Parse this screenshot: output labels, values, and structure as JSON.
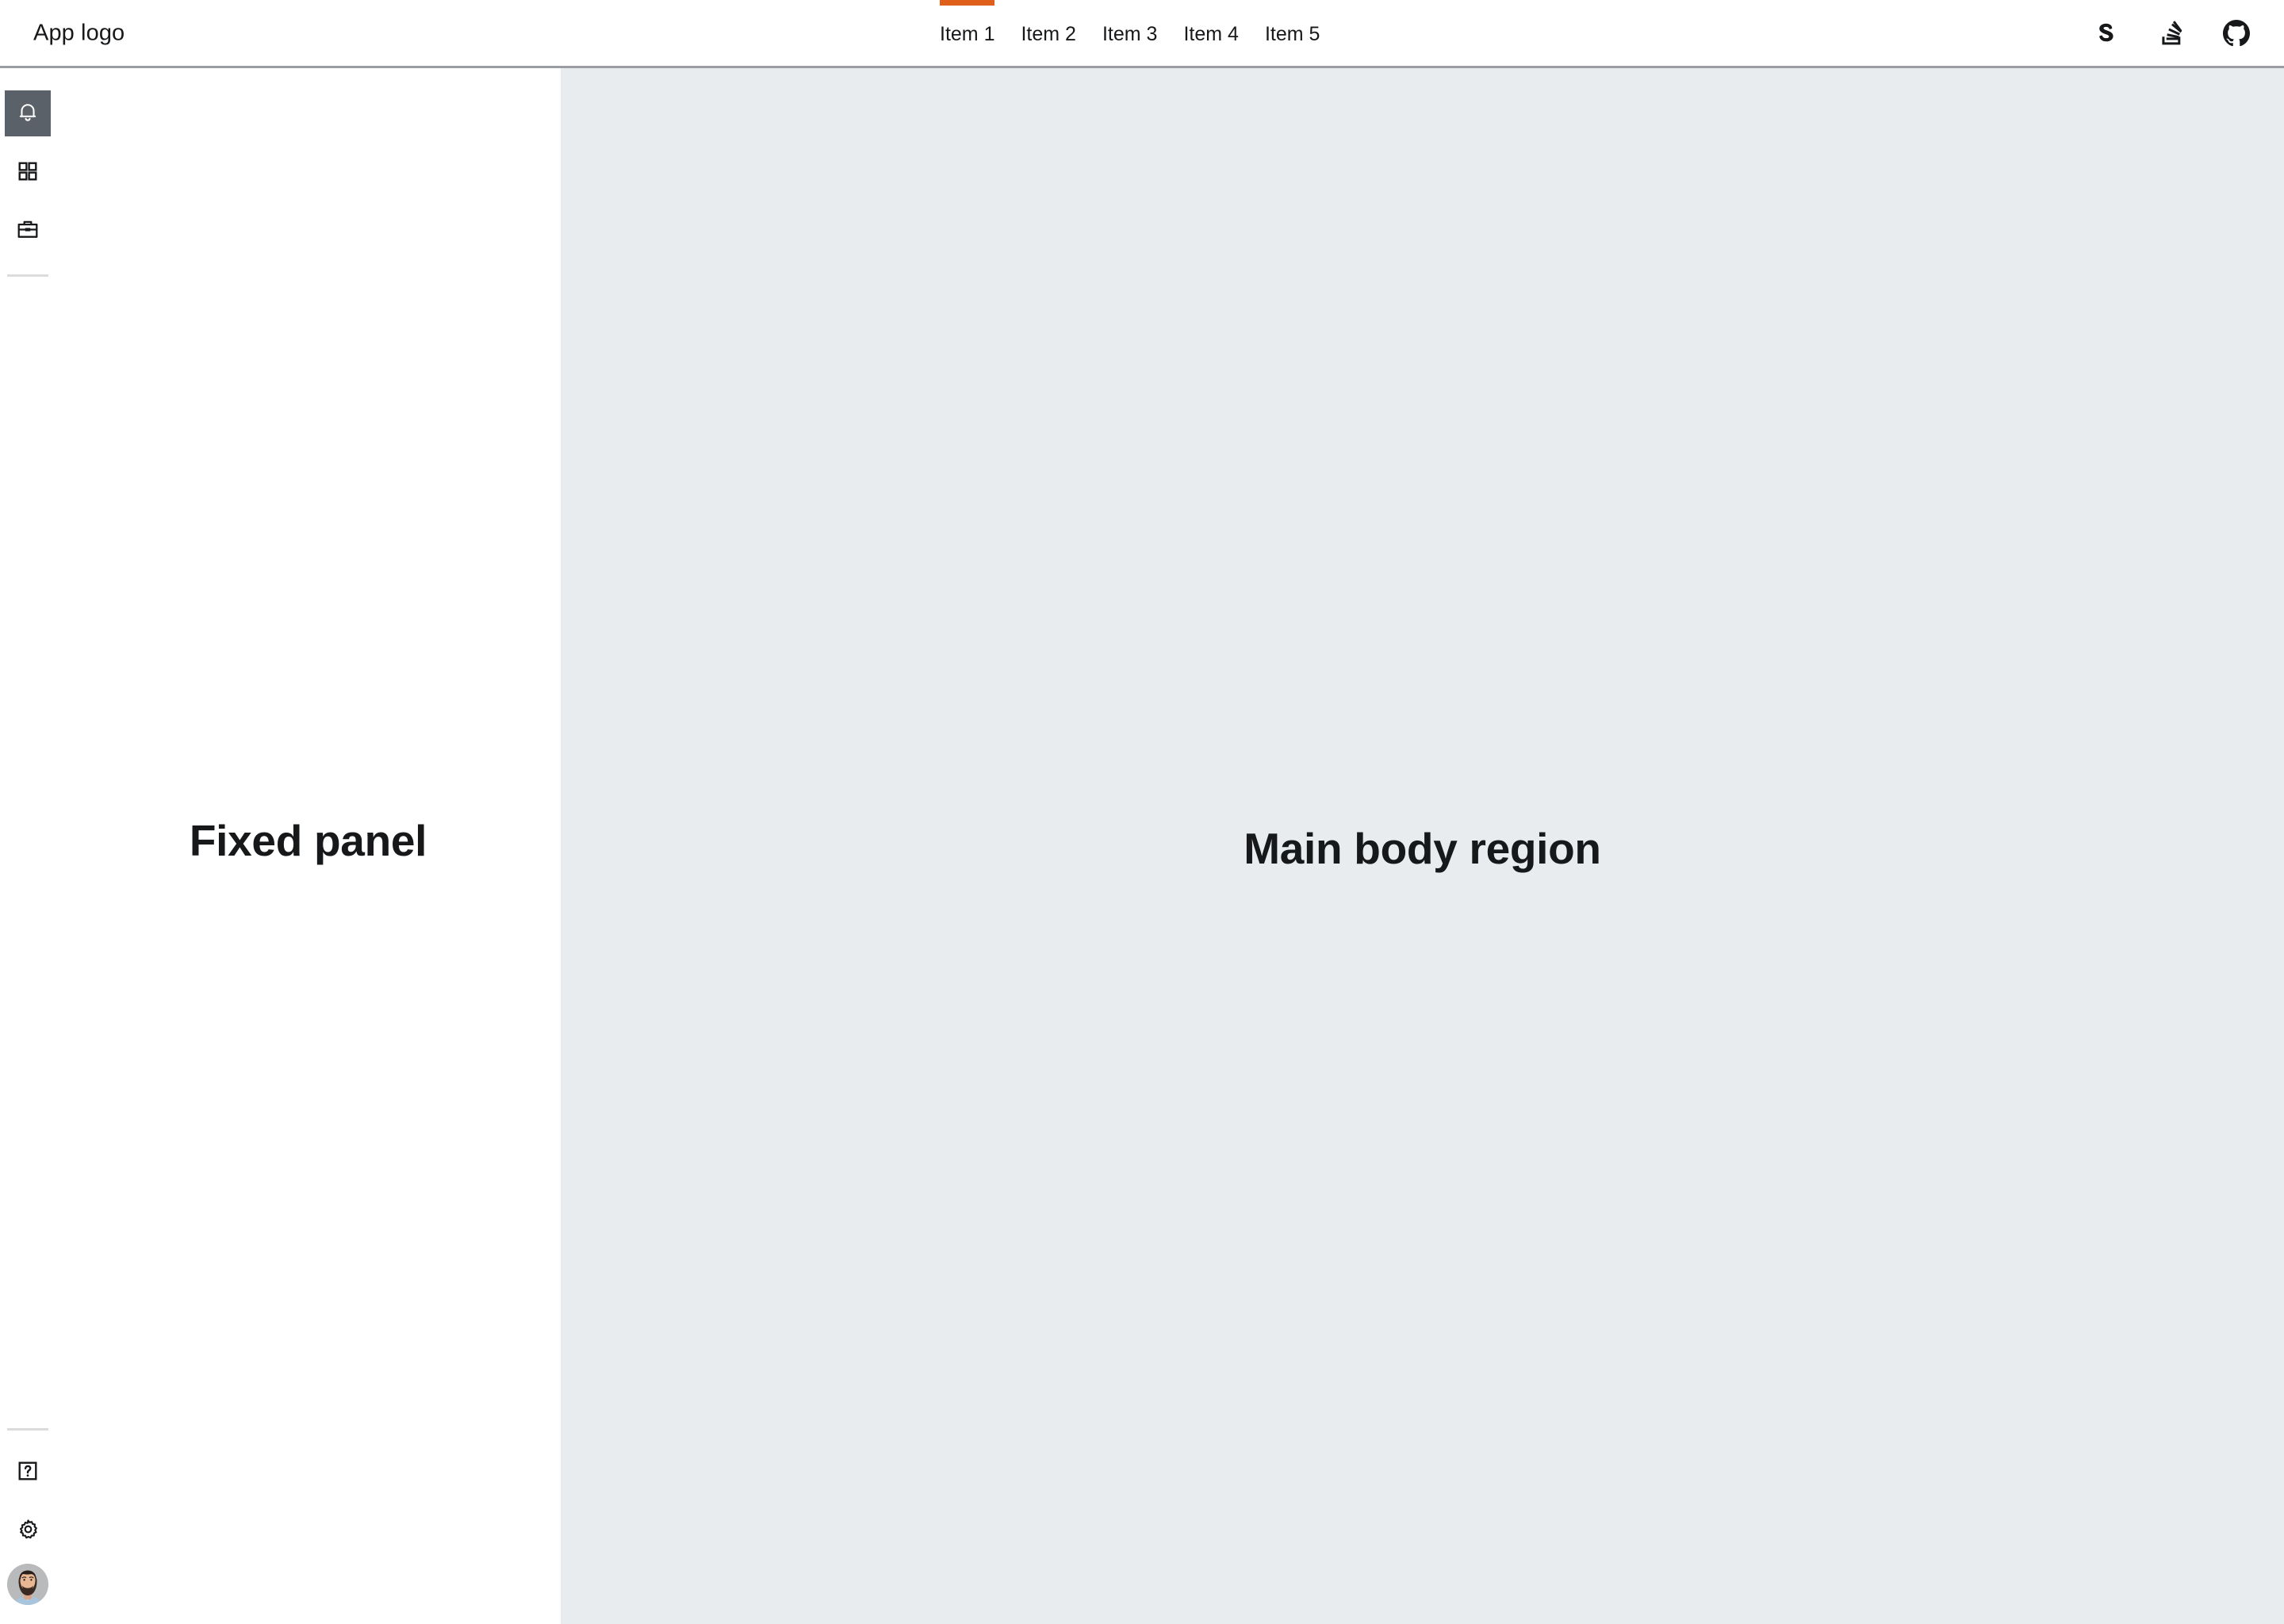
{
  "header": {
    "logo_text": "App logo",
    "nav": [
      {
        "label": "Item 1",
        "active": true
      },
      {
        "label": "Item 2",
        "active": false
      },
      {
        "label": "Item 3",
        "active": false
      },
      {
        "label": "Item 4",
        "active": false
      },
      {
        "label": "Item 5",
        "active": false
      }
    ],
    "actions": [
      {
        "icon": "sass-s-icon",
        "label": "Sass"
      },
      {
        "icon": "stack-overflow-icon",
        "label": "Stack Overflow"
      },
      {
        "icon": "github-icon",
        "label": "GitHub"
      }
    ]
  },
  "rail": {
    "top_items": [
      {
        "icon": "bell-icon",
        "label": "Notifications",
        "active": true
      },
      {
        "icon": "grid-apps-icon",
        "label": "Apps",
        "active": false
      },
      {
        "icon": "briefcase-icon",
        "label": "Work",
        "active": false
      }
    ],
    "bottom_items": [
      {
        "icon": "help-question-icon",
        "label": "Help",
        "active": false
      },
      {
        "icon": "gear-icon",
        "label": "Settings",
        "active": false
      }
    ],
    "avatar": {
      "icon": "user-avatar",
      "label": "User profile"
    }
  },
  "panel": {
    "title": "Fixed panel"
  },
  "main": {
    "title": "Main body region"
  },
  "colors": {
    "accent_orange": "#dd5f19",
    "rail_active_bg": "#5b6169",
    "main_body_bg": "#e9ecee",
    "header_border": "#9a9da1",
    "text": "#16181a",
    "divider": "#dcdcdc"
  }
}
